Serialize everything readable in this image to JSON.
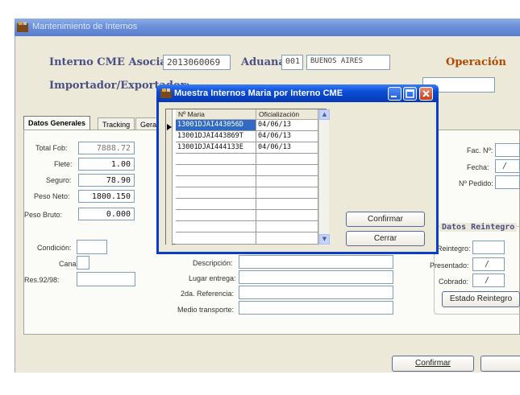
{
  "window": {
    "title": "Mantenimiento de Internos"
  },
  "header": {
    "interno_label": "Interno CME Asociado:",
    "interno_value": "2013060069",
    "aduana_label": "Aduana:",
    "aduana_code": "001",
    "aduana_name": "BUENOS AIRES",
    "operacion_label": "Operación",
    "importador_label": "Importador/Exportador:"
  },
  "tabs": [
    "Datos Generales",
    "Tracking",
    "Gerar"
  ],
  "left_fields": [
    {
      "label": "Total Fob:",
      "value": "7888.72"
    },
    {
      "label": "Flete:",
      "value": "1.00"
    },
    {
      "label": "Seguro:",
      "value": "78.90"
    },
    {
      "label": "Peso Neto:",
      "value": "1800.150"
    },
    {
      "label": "Peso Bruto:",
      "value": "0.000"
    }
  ],
  "extra_left": {
    "condicion": "Condición:",
    "canal": "Canal:",
    "res": "Res.92/98:"
  },
  "mid_fields": [
    "Descripción:",
    "Lugar entrega:",
    "2da. Referencia:",
    "Medio transporte:"
  ],
  "right_fields": {
    "fac": "Fac. Nº:",
    "fecha": "Fecha:",
    "pedido": "Nº Pedido:",
    "fecha_value": "/"
  },
  "reint": {
    "title": "Datos Reintegro",
    "reintegro": "Reintegro:",
    "presentado": "Presentado:",
    "cobrado": "Cobrado:",
    "presentado_value": "/",
    "cobrado_value": "/",
    "estado_button": "Estado Reintegro"
  },
  "footer": {
    "confirmar": "Confirmar"
  },
  "dialog": {
    "title": "Muestra Internos Maria por Interno CME",
    "columns": [
      "Nº Maria",
      "Oficialización"
    ],
    "rows": [
      [
        "13001DJAI443056D",
        "04/06/13"
      ],
      [
        "13001DJAI443869T",
        "04/06/13"
      ],
      [
        "13001DJAI444133E",
        "04/06/13"
      ]
    ],
    "confirm": "Confirmar",
    "close": "Cerrar"
  }
}
